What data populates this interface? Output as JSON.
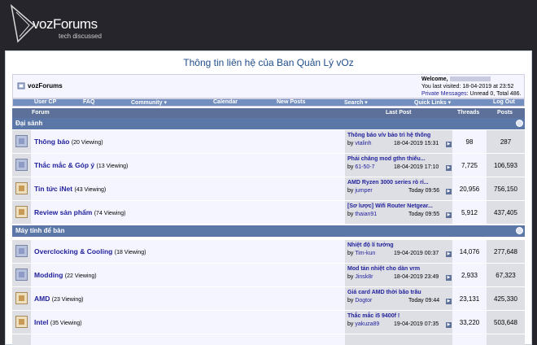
{
  "header": {
    "logo_text": "vozForums",
    "tagline": "tech discussed"
  },
  "notice": "Thông tin liên hệ của Ban Quản Lý vOz",
  "navbar": {
    "site": "vozForums",
    "welcome_label": "Welcome,",
    "last_visited": "You last visited: 18-04-2019 at 23:52",
    "pm_link": "Private Messages",
    "pm_rest": ": Unread 0, Total 486."
  },
  "toolbar": [
    {
      "label": "User CP"
    },
    {
      "label": "FAQ"
    },
    {
      "label": "Community ▾"
    },
    {
      "label": "Calendar"
    },
    {
      "label": "New Posts"
    },
    {
      "label": "Search ▾"
    },
    {
      "label": "Quick Links ▾"
    },
    {
      "label": "Log Out"
    }
  ],
  "columns": {
    "forum": "Forum",
    "last_post": "Last Post",
    "threads": "Threads",
    "posts": "Posts"
  },
  "categories": [
    {
      "name": "Đại sảnh",
      "forums": [
        {
          "name": "Thông báo",
          "viewing": "(20 Viewing)",
          "icon": "folder",
          "last_title": "Thông báo v/v bảo trì hệ thống",
          "last_by": "vtalinh",
          "last_date": "18-04-2019 15:31",
          "threads": "98",
          "posts": "287"
        },
        {
          "name": "Thắc mắc & Góp ý",
          "viewing": "(13 Viewing)",
          "icon": "folder",
          "last_title": "Phải chăng mod gthn thiếu...",
          "last_by": "61-50-7",
          "last_date": "18-04-2019 17:10",
          "threads": "7,725",
          "posts": "106,593"
        },
        {
          "name": "Tin tức iNet",
          "viewing": "(43 Viewing)",
          "icon": "note",
          "last_title": "AMD Ryzen 3000 series rò rỉ...",
          "last_by": "jumper",
          "last_date": "Today 09:56",
          "threads": "20,956",
          "posts": "756,150"
        },
        {
          "name": "Review sản phẩm",
          "viewing": "(74 Viewing)",
          "icon": "note",
          "last_title": "[Sơ lược] Wifi Router Netgear...",
          "last_by": "thaian91",
          "last_date": "Today 09:55",
          "threads": "5,912",
          "posts": "437,405"
        }
      ]
    },
    {
      "name": "Máy tính để bàn",
      "forums": [
        {
          "name": "Overclocking & Cooling",
          "viewing": "(18 Viewing)",
          "icon": "folder",
          "last_title": "Nhiệt độ lí tưởng",
          "last_by": "Tim-kun",
          "last_date": "19-04-2019 00:37",
          "threads": "14,076",
          "posts": "277,648"
        },
        {
          "name": "Modding",
          "viewing": "(22 Viewing)",
          "icon": "folder",
          "last_title": "Mod tản nhiệt cho dàn vrm",
          "last_by": "Jinsk8r",
          "last_date": "18-04-2019 23:49",
          "threads": "2,933",
          "posts": "67,323"
        },
        {
          "name": "AMD",
          "viewing": "(23 Viewing)",
          "icon": "note",
          "last_title": "Giá card AMD thời bão trâu",
          "last_by": "Dogtor",
          "last_date": "Today 09:44",
          "threads": "23,131",
          "posts": "425,330"
        },
        {
          "name": "Intel",
          "viewing": "(35 Viewing)",
          "icon": "note",
          "last_title": "Thắc mắc i5 9400f !",
          "last_by": "yakuza89",
          "last_date": "19-04-2019 07:35",
          "threads": "33,220",
          "posts": "503,648"
        }
      ]
    }
  ]
}
